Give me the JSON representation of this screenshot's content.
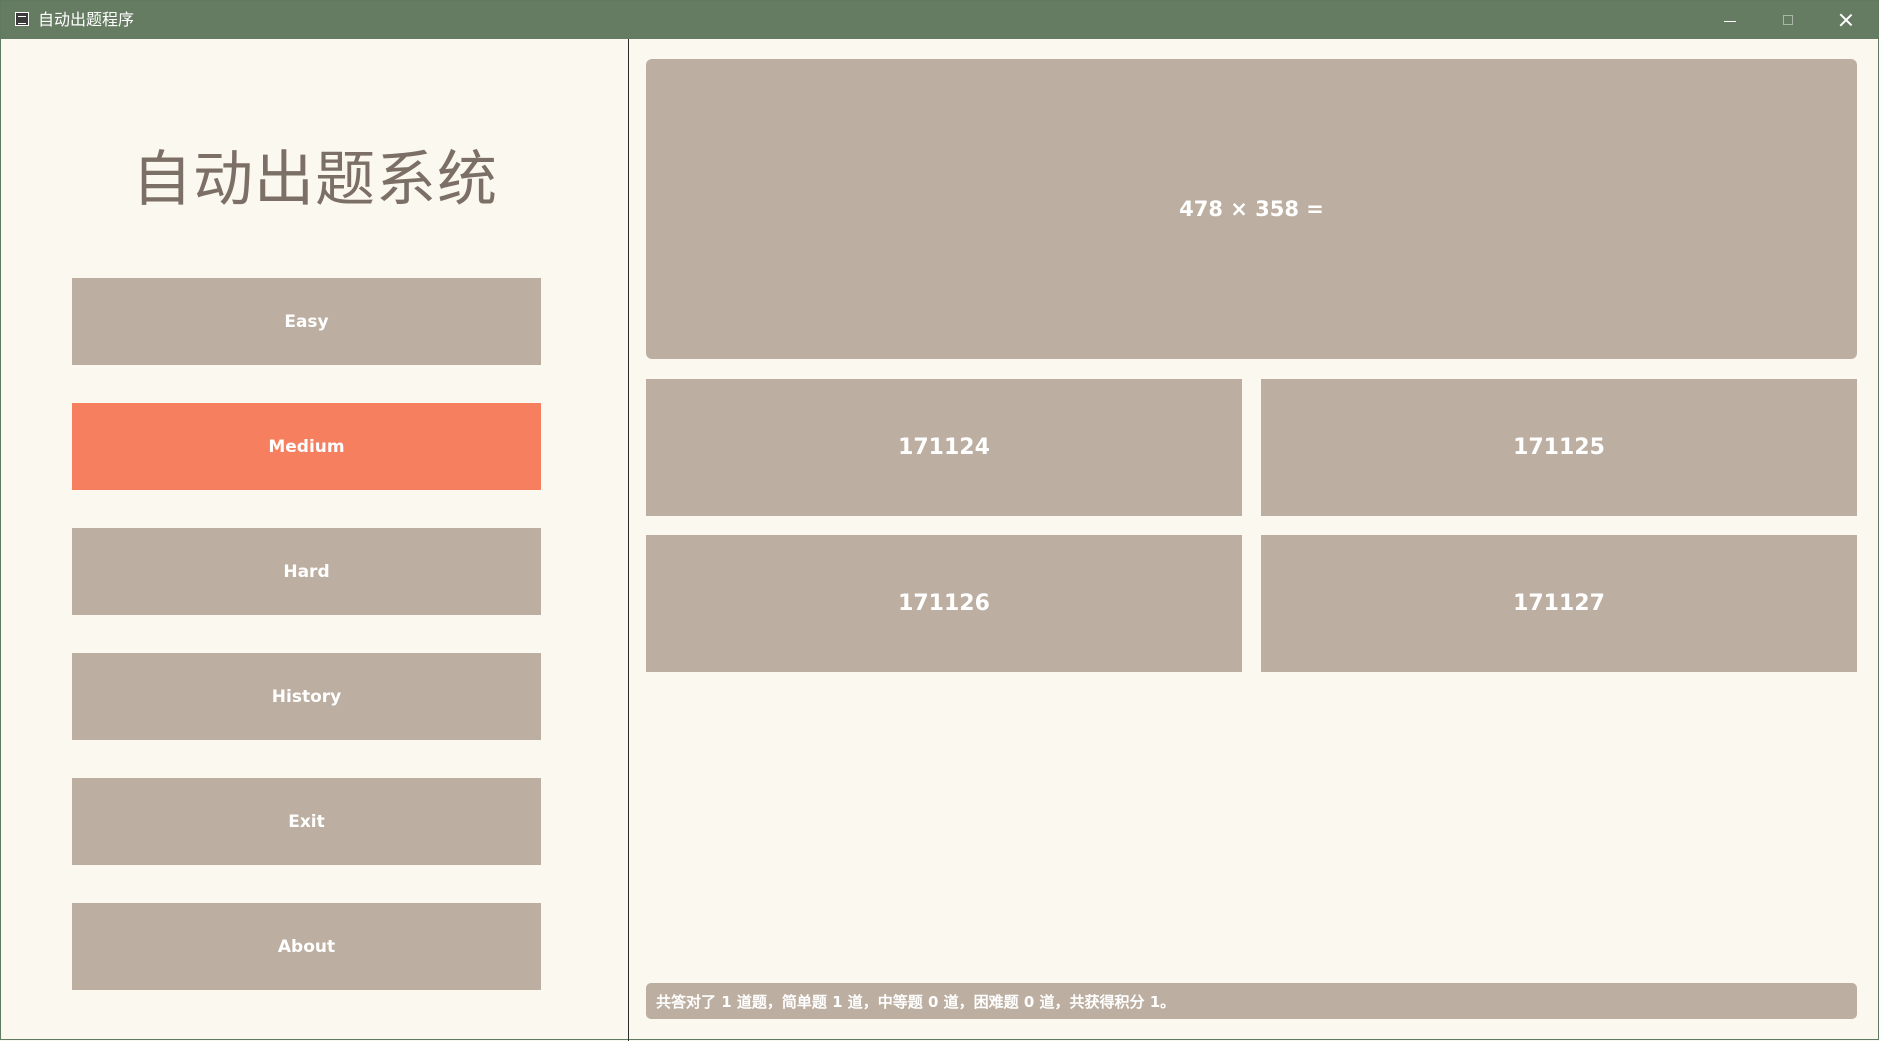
{
  "window": {
    "title": "自动出题程序",
    "controls": {
      "minimize": "minimize-icon",
      "maximize": "maximize-icon",
      "close": "close-icon"
    }
  },
  "sidebar": {
    "title": "自动出题系统",
    "buttons": [
      {
        "label": "Easy",
        "active": false
      },
      {
        "label": "Medium",
        "active": true
      },
      {
        "label": "Hard",
        "active": false
      },
      {
        "label": "History",
        "active": false
      },
      {
        "label": "Exit",
        "active": false
      },
      {
        "label": "About",
        "active": false
      }
    ]
  },
  "main": {
    "question": "478 × 358 =",
    "answers": [
      "171124",
      "171125",
      "171126",
      "171127"
    ],
    "status": "共答对了 1 道题，简单题 1 道，中等题 0 道，困难题 0 道，共获得积分 1。"
  },
  "colors": {
    "titlebar": "#657c62",
    "background": "#fbf8f0",
    "button": "#bcaea0",
    "active_button": "#f67f60",
    "title_text": "#7b6f66"
  }
}
